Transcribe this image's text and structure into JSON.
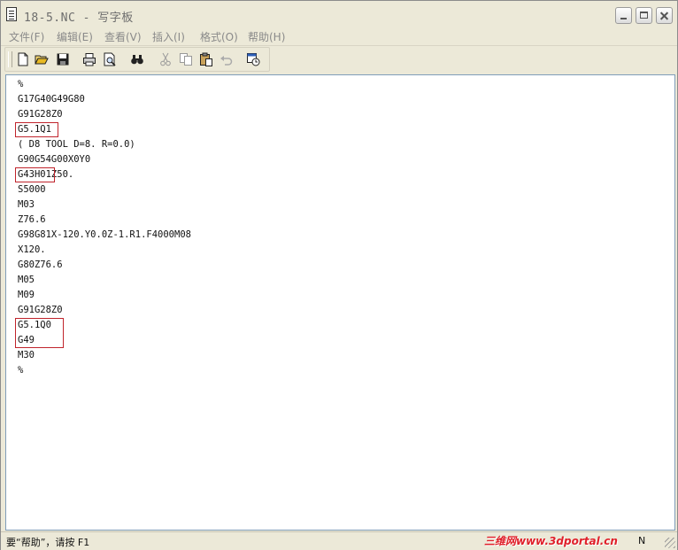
{
  "window": {
    "title": "18-5.NC - 写字板"
  },
  "menu": [
    "文件(F)",
    "编辑(E)",
    "查看(V)",
    "插入(I)",
    "格式(O)",
    "帮助(H)"
  ],
  "toolbar": {
    "icons": [
      "new-file-icon",
      "open-folder-icon",
      "save-icon",
      "print-icon",
      "print-preview-icon",
      "find-icon",
      "cut-icon",
      "copy-icon",
      "paste-icon",
      "undo-icon",
      "insert-date-time-icon"
    ]
  },
  "editor": {
    "lines": [
      "%",
      "G17G40G49G80",
      "G91G28Z0",
      "G5.1Q1",
      "( D8 TOOL D=8. R=0.0)",
      "G90G54G00X0Y0",
      "G43H01Z50.",
      "S5000",
      "M03",
      "Z76.6",
      "G98G81X-120.Y0.0Z-1.R1.F4000M08",
      "X120.",
      "G80Z76.6",
      "M05",
      "M09",
      "G91G28Z0",
      "G5.1Q0",
      "G49",
      "M30",
      "%"
    ]
  },
  "status": {
    "help_text": "要“帮助”，请按 F1",
    "watermark": "三维网www.3dportal.cn",
    "right_indicator": "N"
  }
}
